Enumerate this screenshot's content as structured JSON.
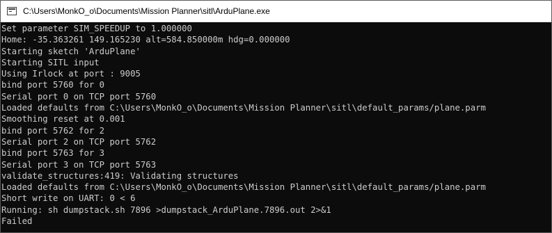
{
  "window": {
    "title": "C:\\Users\\MonkO_o\\Documents\\Mission Planner\\sitl\\ArduPlane.exe",
    "icon": "console-window-icon",
    "background_color": "#0c0c0c",
    "text_color": "#cccccc"
  },
  "console": {
    "lines": [
      "Set parameter SIM_SPEEDUP to 1.000000",
      "Home: -35.363261 149.165230 alt=584.850000m hdg=0.000000",
      "Starting sketch 'ArduPlane'",
      "Starting SITL input",
      "Using Irlock at port : 9005",
      "bind port 5760 for 0",
      "Serial port 0 on TCP port 5760",
      "Loaded defaults from C:\\Users\\MonkO_o\\Documents\\Mission Planner\\sitl\\default_params/plane.parm",
      "Smoothing reset at 0.001",
      "bind port 5762 for 2",
      "Serial port 2 on TCP port 5762",
      "bind port 5763 for 3",
      "Serial port 3 on TCP port 5763",
      "validate_structures:419: Validating structures",
      "Loaded defaults from C:\\Users\\MonkO_o\\Documents\\Mission Planner\\sitl\\default_params/plane.parm",
      "Short write on UART: 0 < 6",
      "Running: sh dumpstack.sh 7896 >dumpstack_ArduPlane.7896.out 2>&1",
      "Failed"
    ]
  }
}
